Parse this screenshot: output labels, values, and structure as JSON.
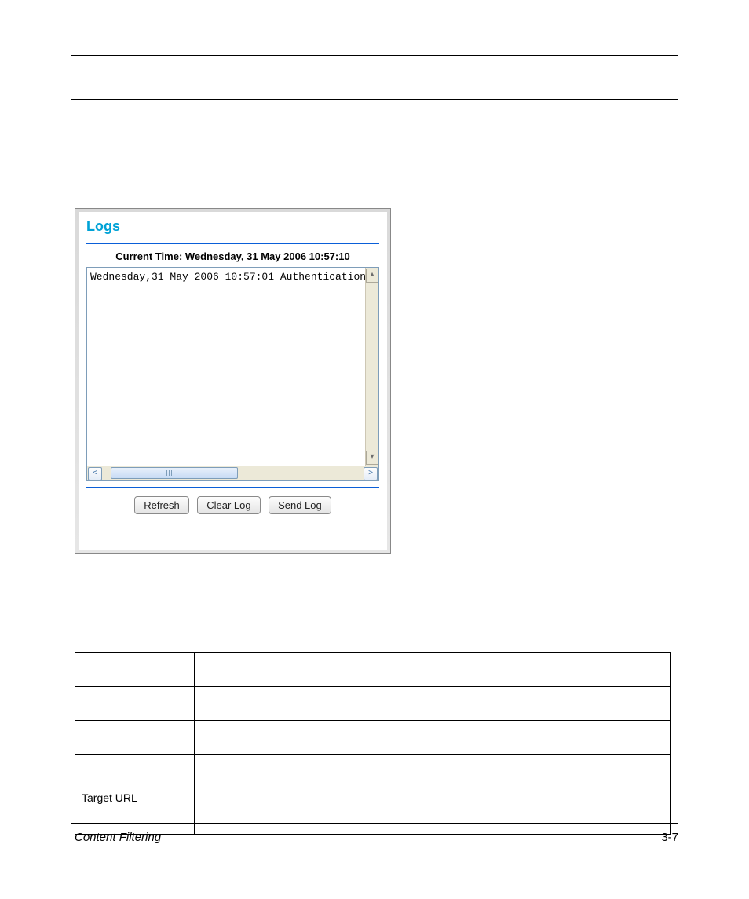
{
  "panel": {
    "title": "Logs",
    "current_time_label": "Current Time: Wednesday, 31 May 2006 10:57:10",
    "log_line": "Wednesday,31 May 2006 10:57:01 Authentication",
    "buttons": {
      "refresh": "Refresh",
      "clear": "Clear Log",
      "send": "Send Log"
    }
  },
  "table": {
    "r4c1": "Target URL"
  },
  "footer": {
    "left": "Content Filtering",
    "right": "3-7"
  },
  "glyphs": {
    "up": "▴",
    "down": "▾",
    "left": "<",
    "right": ">"
  }
}
